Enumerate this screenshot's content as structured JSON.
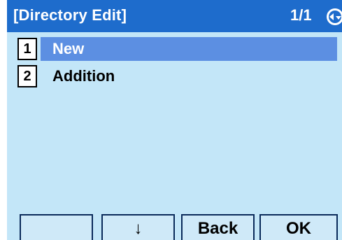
{
  "header": {
    "title": "[Directory Edit]",
    "page": "1/1",
    "nav_icon": "up-down-navigation-icon"
  },
  "menu": {
    "items": [
      {
        "number": "1",
        "label": "New",
        "selected": true
      },
      {
        "number": "2",
        "label": "Addition",
        "selected": false
      }
    ]
  },
  "softkeys": {
    "key1": "",
    "key2": "↓",
    "key3": "Back",
    "key4": "OK"
  },
  "colors": {
    "header_bg": "#1e6ccc",
    "screen_bg": "#c3e6f8",
    "selected_bg": "#5c8fe2"
  }
}
